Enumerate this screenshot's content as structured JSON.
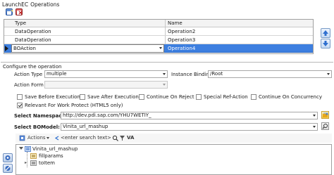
{
  "breadcrumb": {
    "root": "LaunchEC",
    "current": "Operations"
  },
  "grid": {
    "headers": {
      "type": "Type",
      "name": "Name"
    },
    "rows": [
      {
        "type": "DataOperation",
        "name": "Operation2",
        "selected": false
      },
      {
        "type": "DataOperation",
        "name": "Operation3",
        "selected": false
      },
      {
        "type": "BOAction",
        "name": "Operation4",
        "selected": true
      }
    ]
  },
  "configure": {
    "title": "Configure the operation",
    "action_type_label": "Action Type",
    "action_type_value": "multiple",
    "instance_binding_label": "Instance Binding",
    "instance_binding_value": "/Root",
    "action_form_label": "Action Form",
    "action_form_value": "",
    "checkboxes": [
      {
        "label": "Save Before Execution",
        "checked": false
      },
      {
        "label": "Save After Execution",
        "checked": false
      },
      {
        "label": "Continue On Reject",
        "checked": false
      },
      {
        "label": "Special Ref-Action",
        "checked": false
      },
      {
        "label": "Continue On Concurrency",
        "checked": false
      },
      {
        "label": "Relevant For Work Protect (HTML5 only)",
        "checked": true
      }
    ],
    "namespace_label": "Select Namespace:",
    "namespace_value": "http://dev.pdi.sap.com/YHU7WETIY_",
    "bomodel_label": "Select BOModel:",
    "bomodel_value": "Vinita_url_mashup"
  },
  "tree_toolbar": {
    "actions_label": "Actions",
    "search_placeholder": "<enter search text>",
    "va_label": "VA"
  },
  "tree": {
    "root": "Vinita_url_mashup",
    "children": [
      "fillparams",
      "toItem"
    ]
  },
  "colors": {
    "selection": "#3d7fe0",
    "accent_blue": "#2f6fcf"
  }
}
